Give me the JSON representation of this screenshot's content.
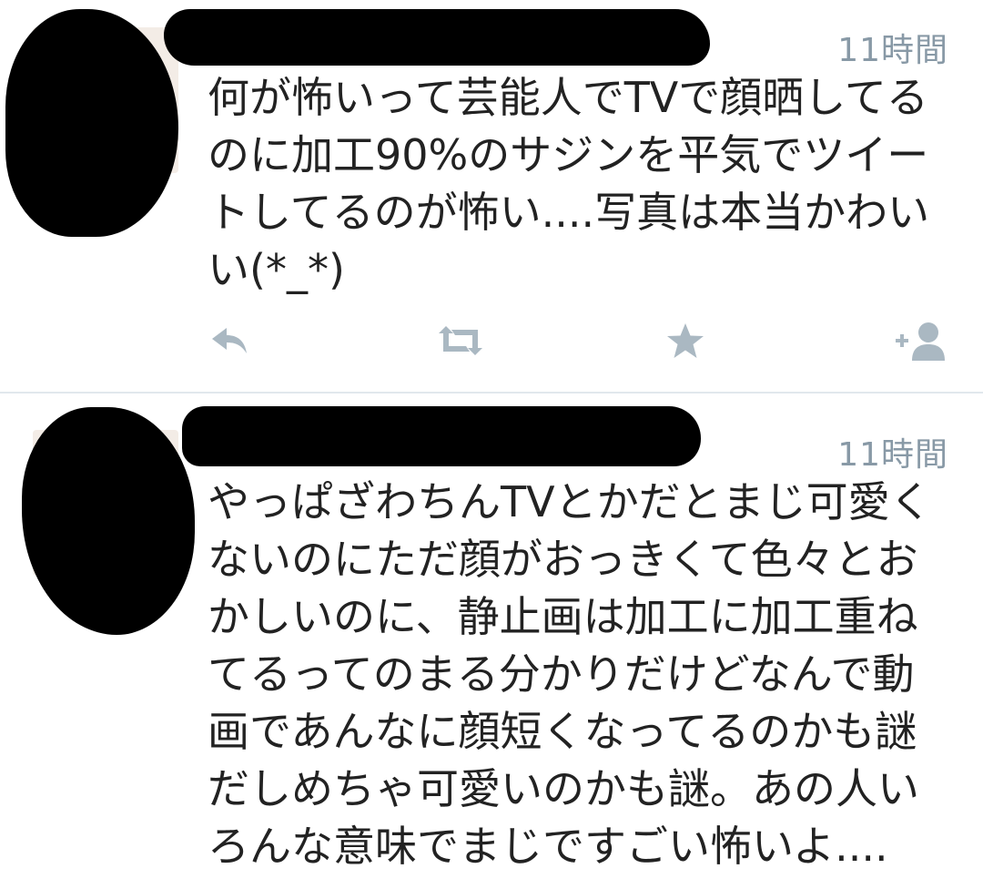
{
  "tweets": [
    {
      "timestamp": "11時間",
      "text": "何が怖いって芸能人でTVで顔晒してるのに加工90%のサジンを平気でツイートしてるのが怖い....写真は本当かわいい(*_*)",
      "actions": {
        "reply_icon": "reply-icon",
        "retweet_icon": "retweet-icon",
        "favorite_icon": "star-icon",
        "follow_icon": "follow-icon"
      }
    },
    {
      "timestamp": "11時間",
      "text": "やっぱざわちんTVとかだとまじ可愛くないのにただ顔がおっきくて色々とおかしいのに、静止画は加工に加工重ねてるってのまる分かりだけどなんで動画であんなに顔短くなってるのかも謎だしめちゃ可愛いのかも謎。あの人いろんな意味でまじですごい怖いよ...."
    }
  ],
  "colors": {
    "text": "#222222",
    "timestamp": "#8899a6",
    "action_icon": "#aab8c2",
    "divider": "#e1e8ed",
    "redaction": "#000000"
  }
}
